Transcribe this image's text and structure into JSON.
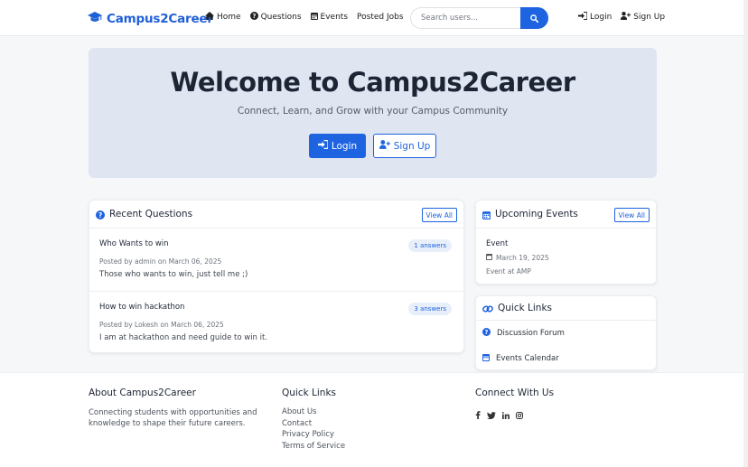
{
  "navbar": {
    "brand": "Campus2Career",
    "links": {
      "home": "Home",
      "questions": "Questions",
      "events": "Events",
      "posted_jobs": "Posted Jobs"
    },
    "search_placeholder": "Search users...",
    "login": "Login",
    "signup": "Sign Up"
  },
  "hero": {
    "title": "Welcome to Campus2Career",
    "subtitle": "Connect, Learn, and Grow with your Campus Community",
    "login_label": "Login",
    "signup_label": "Sign Up"
  },
  "recent_questions": {
    "title": "Recent Questions",
    "view_all": "View All",
    "items": [
      {
        "title": "Who Wants to win",
        "answers": "1 answers",
        "meta": "Posted by admin on March 06, 2025",
        "body": "Those who wants to win, just tell me ;)"
      },
      {
        "title": "How to win hackathon",
        "answers": "3 answers",
        "meta": "Posted by Lokesh on March 06, 2025",
        "body": "I am at hackathon and need guide to win it."
      }
    ]
  },
  "upcoming_events": {
    "title": "Upcoming Events",
    "view_all": "View All",
    "items": [
      {
        "title": "Event",
        "date": "March 19, 2025",
        "location": "Event at AMP"
      }
    ]
  },
  "quick_links_card": {
    "title": "Quick Links",
    "items": [
      {
        "label": "Discussion Forum",
        "icon": "question-circle-icon"
      },
      {
        "label": "Events Calendar",
        "icon": "calendar-icon"
      }
    ]
  },
  "footer": {
    "about_title": "About Campus2Career",
    "about_text": "Connecting students with opportunities and knowledge to shape their future careers.",
    "links_title": "Quick Links",
    "links": [
      "About Us",
      "Contact",
      "Privacy Policy",
      "Terms of Service"
    ],
    "connect_title": "Connect With Us",
    "social_icons": [
      "facebook-icon",
      "twitter-icon",
      "linkedin-icon",
      "instagram-icon"
    ]
  },
  "colors": {
    "primary": "#1e63e0",
    "hero_bg": "#dfe5f1",
    "page_bg": "#f6f7f9",
    "text_dark": "#1d2535"
  }
}
